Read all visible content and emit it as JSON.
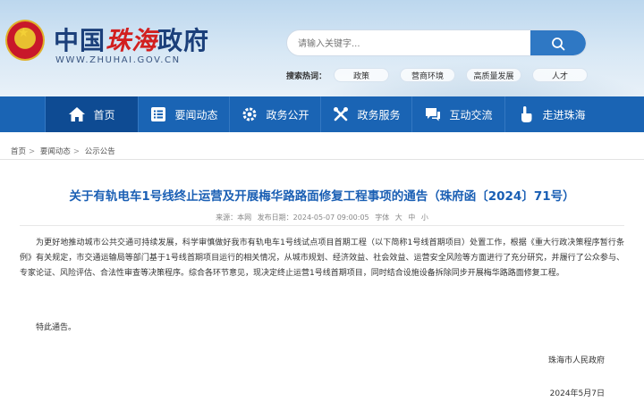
{
  "header": {
    "logo_cn_part1": "中国",
    "logo_cn_part2": "珠海",
    "logo_cn_part3": "政府",
    "logo_en": "WWW.ZHUHAI.GOV.CN",
    "emblem_icon": "national-emblem-icon",
    "search": {
      "placeholder": "请输入关键字...",
      "icon": "search-icon"
    },
    "hot_label": "搜索热词：",
    "hot_words": [
      "政策",
      "营商环境",
      "高质量发展",
      "人才"
    ]
  },
  "nav": {
    "items": [
      {
        "label": "首页",
        "icon": "home-icon",
        "active": true
      },
      {
        "label": "要闻动态",
        "icon": "news-list-icon",
        "active": false
      },
      {
        "label": "政务公开",
        "icon": "gear-icon",
        "active": false
      },
      {
        "label": "政务服务",
        "icon": "tools-icon",
        "active": false
      },
      {
        "label": "互动交流",
        "icon": "chat-icon",
        "active": false
      },
      {
        "label": "走进珠海",
        "icon": "hand-pointer-icon",
        "active": false
      }
    ]
  },
  "breadcrumb": [
    "首页",
    "要闻动态",
    "公示公告"
  ],
  "article": {
    "title": "关于有轨电车1号线终止运营及开展梅华路路面修复工程事项的通告（珠府函〔2024〕71号）",
    "meta": {
      "source": "来源：本网",
      "date": "发布日期：2024-05-07 09:00:05",
      "font_label": "字体",
      "font_large": "大",
      "font_medium": "中",
      "font_small": "小"
    },
    "body": "为更好地推动城市公共交通可持续发展，科学审慎做好我市有轨电车1号线试点项目首期工程（以下简称1号线首期项目）处置工作，根据《重大行政决策程序暂行条例》有关规定，市交通运输局等部门基于1号线首期项目运行的相关情况，从城市规划、经济效益、社会效益、运营安全风险等方面进行了充分研究，并履行了公众参与、专家论证、风险评估、合法性审查等决策程序。综合各环节意见，现决定终止运营1号线首期项目，同时结合设施设备拆除同步开展梅华路路面修复工程。",
    "notice": "特此通告。",
    "signer": "珠海市人民政府",
    "date": "2024年5月7日"
  },
  "colors": {
    "nav_bg": "#1a64b4",
    "nav_active": "#0e4b93",
    "title": "#1a5fb4",
    "logo_accent": "#d21f1f"
  }
}
